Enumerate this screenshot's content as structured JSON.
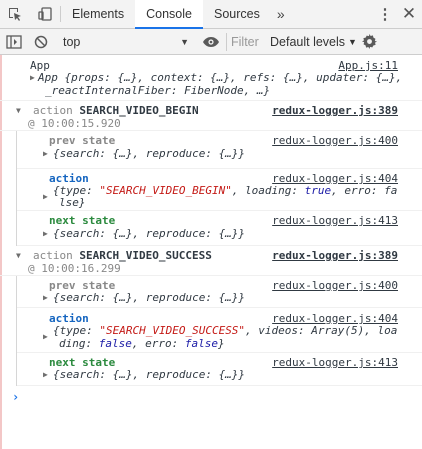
{
  "tabs": {
    "elements": "Elements",
    "console": "Console",
    "sources": "Sources",
    "more": "»"
  },
  "toolbar": {
    "context": "top",
    "filter_placeholder": "Filter",
    "levels": "Default levels"
  },
  "log": {
    "app": {
      "label": "App",
      "source": "App.js:11",
      "line1": "App {props: {…}, context: {…}, refs: {…}, updater: {…},",
      "line2": "_reactInternalFiber: FiberNode, …}"
    },
    "groups": [
      {
        "title": "action SEARCH_VIDEO_BEGIN",
        "action_word": "action",
        "action_type": "SEARCH_VIDEO_BEGIN",
        "time": "@ 10:00:15.920",
        "source": "redux-logger.js:389",
        "prev_label": "prev state",
        "prev_source": "redux-logger.js:400",
        "prev_value": "{search: {…}, reproduce: {…}}",
        "action_label": "action",
        "action_source": "redux-logger.js:404",
        "action_value_1": "{type: ",
        "action_value_str": "\"SEARCH_VIDEO_BEGIN\"",
        "action_value_2": ", loading: ",
        "action_value_kw": "true",
        "action_value_3": ", erro: fa",
        "action_value_line2": "lse}",
        "next_label": "next state",
        "next_source": "redux-logger.js:413",
        "next_value": "{search: {…}, reproduce: {…}}"
      },
      {
        "title": "action SEARCH_VIDEO_SUCCESS",
        "action_word": "action",
        "action_type": "SEARCH_VIDEO_SUCCESS",
        "time": "@ 10:00:16.299",
        "source": "redux-logger.js:389",
        "prev_label": "prev state",
        "prev_source": "redux-logger.js:400",
        "prev_value": "{search: {…}, reproduce: {…}}",
        "action_label": "action",
        "action_source": "redux-logger.js:404",
        "action_value_1": "{type: ",
        "action_value_str": "\"SEARCH_VIDEO_SUCCESS\"",
        "action_value_2": ", videos: Array(5), loa",
        "action_value_line2a": "ding: ",
        "action_value_kw1": "false",
        "action_value_line2b": ", erro: ",
        "action_value_kw2": "false",
        "action_value_line2c": "}",
        "next_label": "next state",
        "next_source": "redux-logger.js:413",
        "next_value": "{search: {…}, reproduce: {…}}"
      }
    ],
    "prompt": "›"
  },
  "colors": {
    "accent": "#1a73e8",
    "action_blue": "#1565c0",
    "state_green": "#2b8a3e",
    "string_red": "#c41a16"
  }
}
